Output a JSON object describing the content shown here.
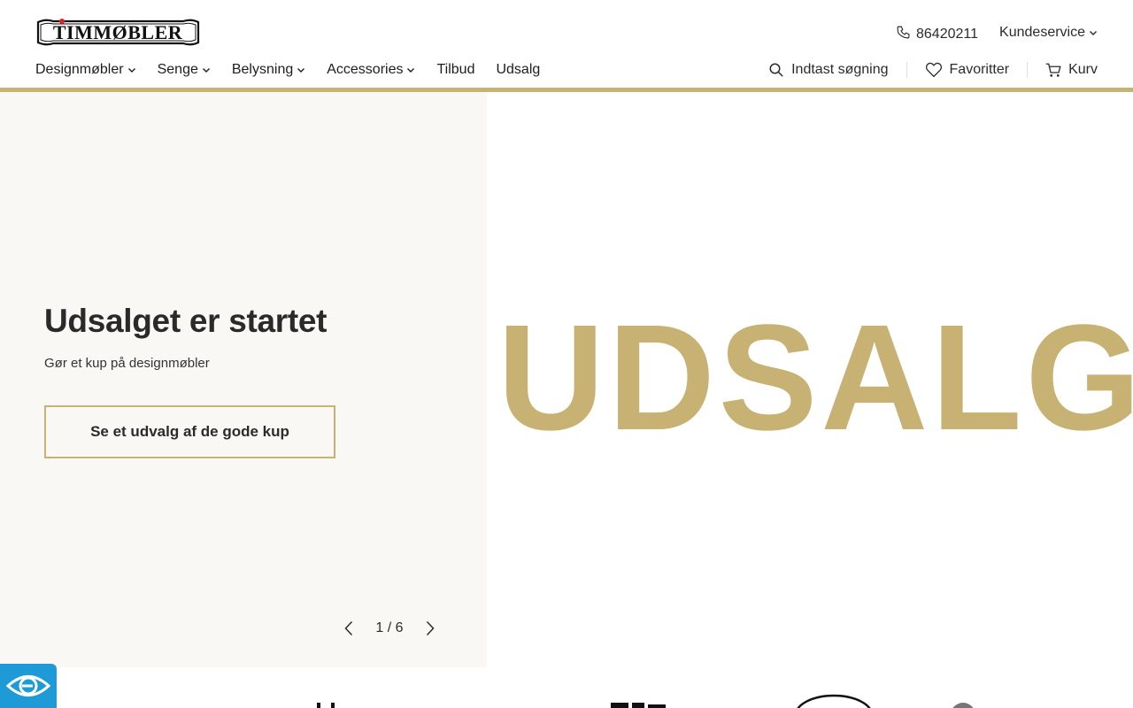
{
  "header": {
    "logo_text": "TIMMØBLER",
    "phone": "86420211",
    "customer_service": "Kundeservice",
    "nav": [
      {
        "label": "Designmøbler",
        "has_dropdown": true
      },
      {
        "label": "Senge",
        "has_dropdown": true
      },
      {
        "label": "Belysning",
        "has_dropdown": true
      },
      {
        "label": "Accessories",
        "has_dropdown": true
      },
      {
        "label": "Tilbud",
        "has_dropdown": false
      },
      {
        "label": "Udsalg",
        "has_dropdown": false
      }
    ],
    "search_placeholder": "Indtast søgning",
    "favorites": "Favoritter",
    "cart": "Kurv"
  },
  "hero": {
    "title": "Udsalget er startet",
    "subtitle": "Gør et kup på designmøbler",
    "cta": "Se et udvalg af de gode kup",
    "pager": "1 / 6",
    "big_word": "UDSALG"
  },
  "colors": {
    "accent": "#c8b273",
    "hero_left_bg": "#f9f8f5",
    "widget": "#1e9bd7"
  },
  "icons": {
    "phone": "phone-icon",
    "search": "search-icon",
    "favorites": "heart-icon",
    "cart": "cart-icon",
    "accessibility": "eye-icon"
  }
}
